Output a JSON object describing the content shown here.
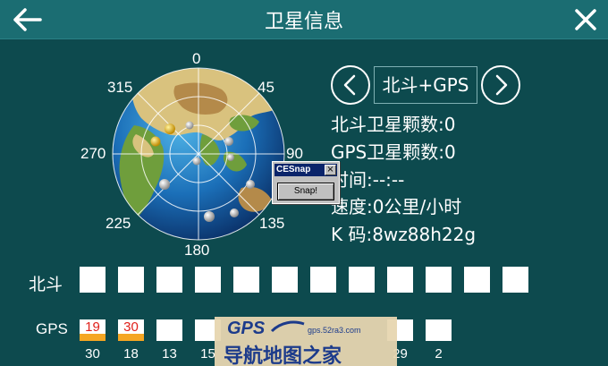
{
  "header": {
    "title": "卫星信息"
  },
  "compass": {
    "labels": {
      "n": "0",
      "ne": "45",
      "e": "90",
      "se": "135",
      "s": "180",
      "sw": "225",
      "w": "270",
      "nw": "315"
    }
  },
  "mode": {
    "label": "北斗+GPS"
  },
  "info": {
    "beidou_count": "北斗卫星颗数:0",
    "gps_count": "GPS卫星颗数:0",
    "time": "时间:--:--",
    "speed": "速度:0公里/小时",
    "kcode": "K 码:8wz88h22g"
  },
  "cesnap": {
    "caption": "CESnap",
    "close": "×",
    "button": "Snap!"
  },
  "beidou_row": {
    "label": "北斗"
  },
  "gps_row": {
    "label": "GPS",
    "signals": [
      {
        "snr": "19",
        "prn": "30"
      },
      {
        "snr": "30",
        "prn": "18"
      },
      {
        "snr": "",
        "prn": "13"
      },
      {
        "snr": "",
        "prn": "15"
      },
      {
        "snr": "",
        "prn": "29"
      },
      {
        "snr": "",
        "prn": "2"
      }
    ]
  },
  "watermark": {
    "brand": "GPS",
    "url": "gps.52ra3.com",
    "text": "导航地图之家"
  },
  "colors": {
    "background": "#0d4a4e",
    "titlebar": "#1b6d72",
    "signal_bar": "#f5a623",
    "snr_text": "#e0201a"
  }
}
